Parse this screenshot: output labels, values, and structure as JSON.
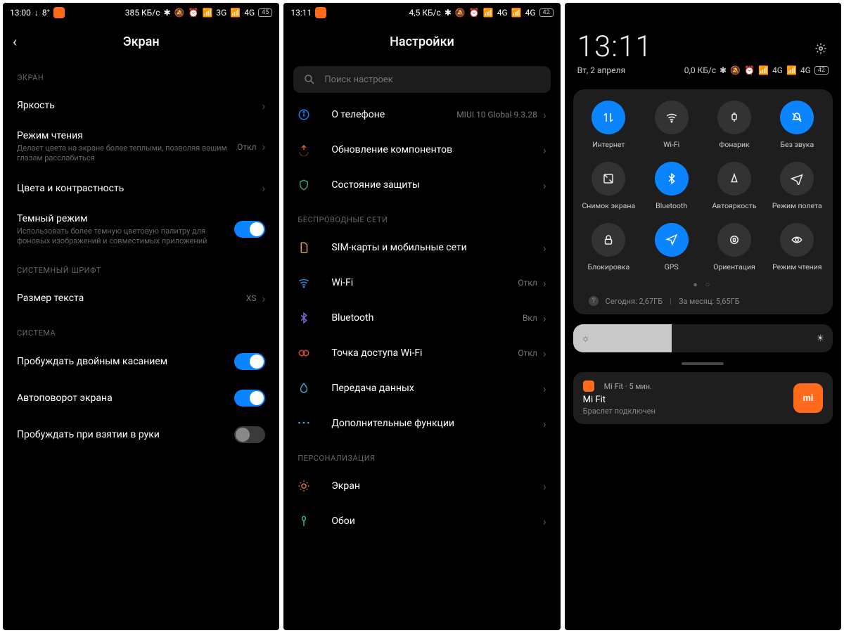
{
  "phone1": {
    "status": {
      "time": "13:00",
      "down": "↓",
      "temp": "8°",
      "speed": "385 КБ/с",
      "net": "3G",
      "net2": "4G",
      "batt": "45"
    },
    "title": "Экран",
    "sections": {
      "display": "ЭКРАН",
      "font": "СИСТЕМНЫЙ ШРИФТ",
      "system": "СИСТЕМА"
    },
    "rows": {
      "brightness": "Яркость",
      "reading": {
        "label": "Режим чтения",
        "sub": "Делает цвета на экране более теплыми, позволяя вашим глазам расслабиться",
        "value": "Откл"
      },
      "colors": "Цвета и контрастность",
      "dark": {
        "label": "Темный режим",
        "sub": "Использовать более темную цветовую палитру для фоновых изображений и совместимых приложений"
      },
      "textsize": {
        "label": "Размер текста",
        "value": "XS"
      },
      "dtap": "Пробуждать двойным касанием",
      "autorotate": "Автоповорот экрана",
      "raise": "Пробуждать при взятии в руки"
    }
  },
  "phone2": {
    "status": {
      "time": "13:11",
      "speed": "4,5 КБ/с",
      "net": "4G",
      "net2": "4G",
      "batt": "42"
    },
    "title": "Настройки",
    "search_ph": "Поиск настроек",
    "sections": {
      "wireless": "БЕСПРОВОДНЫЕ СЕТИ",
      "personal": "ПЕРСОНАЛИЗАЦИЯ"
    },
    "rows": {
      "about": {
        "label": "О телефоне",
        "value": "MIUI 10 Global 9.3.28"
      },
      "update": "Обновление компонентов",
      "security": "Состояние защиты",
      "sim": "SIM-карты и мобильные сети",
      "wifi": {
        "label": "Wi-Fi",
        "value": "Откл"
      },
      "bt": {
        "label": "Bluetooth",
        "value": "Вкл"
      },
      "hotspot": {
        "label": "Точка доступа Wi-Fi",
        "value": "Откл"
      },
      "data": "Передача данных",
      "more": "Дополнительные функции",
      "screen": "Экран",
      "wallpaper": "Обои"
    }
  },
  "phone3": {
    "clock": "13:11",
    "date": "Вт, 2 апреля",
    "status": {
      "speed": "0,0 КБ/с",
      "net": "4G",
      "net2": "4G",
      "batt": "42"
    },
    "tiles": [
      {
        "id": "internet",
        "label": "Интернет",
        "on": true
      },
      {
        "id": "wifi",
        "label": "Wi-Fi",
        "on": false
      },
      {
        "id": "flash",
        "label": "Фонарик",
        "on": false
      },
      {
        "id": "dnd",
        "label": "Без звука",
        "on": true
      },
      {
        "id": "screenshot",
        "label": "Снимок экрана",
        "on": false
      },
      {
        "id": "bt",
        "label": "Bluetooth",
        "on": true
      },
      {
        "id": "autobright",
        "label": "Автояркость",
        "on": false
      },
      {
        "id": "airplane",
        "label": "Режим полета",
        "on": false
      },
      {
        "id": "lock",
        "label": "Блокировка",
        "on": false
      },
      {
        "id": "gps",
        "label": "GPS",
        "on": true
      },
      {
        "id": "orientation",
        "label": "Ориентация",
        "on": false
      },
      {
        "id": "reading",
        "label": "Режим чтения",
        "on": false
      }
    ],
    "data_usage": {
      "today": "Сегодня: 2,67ГБ",
      "month": "За месяц: 5,65ГБ"
    },
    "notif": {
      "app": "Mi Fit",
      "age": "5 мин.",
      "title": "Mi Fit",
      "body": "Браслет подключен",
      "badge": "mi"
    }
  }
}
